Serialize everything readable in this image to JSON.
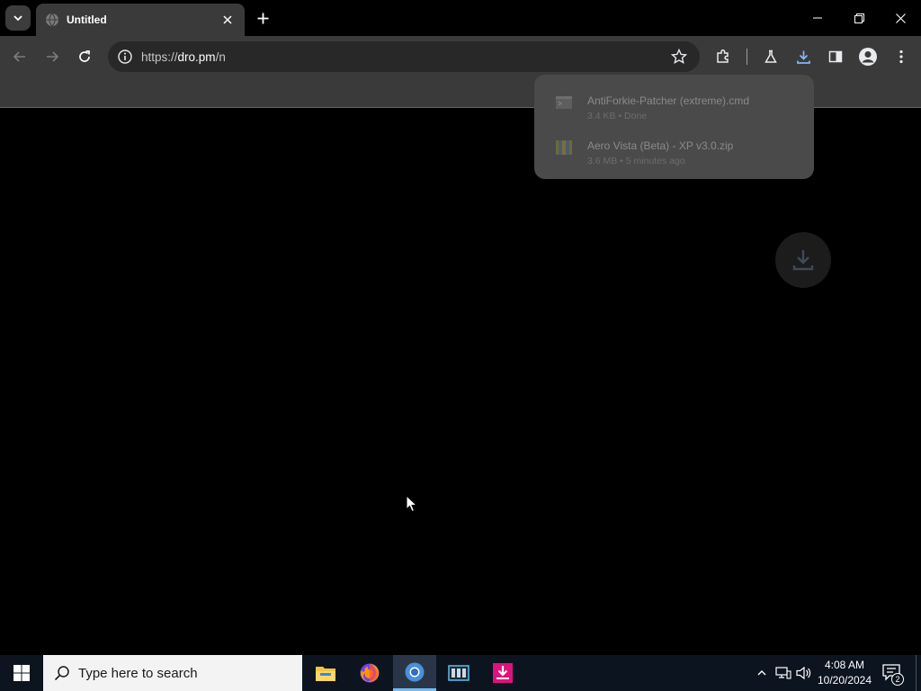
{
  "browser": {
    "tab": {
      "title": "Untitled"
    },
    "omnibox": {
      "url_scheme": "https://",
      "url_domain": "dro.pm",
      "url_path": "/n"
    },
    "downloads": [
      {
        "name": "AntiForkie-Patcher (extreme).cmd",
        "status": "3.4 KB • Done",
        "icon": "cmd-file-icon"
      },
      {
        "name": "Aero Vista (Beta) - XP v3.0.zip",
        "status": "3.6 MB • 5 minutes ago",
        "icon": "zip-file-icon"
      }
    ]
  },
  "taskbar": {
    "search_placeholder": "Type here to search",
    "apps": [
      "file-explorer",
      "firefox",
      "chrome",
      "video-editor",
      "download-manager"
    ],
    "clock": {
      "time": "4:08 AM",
      "date": "10/20/2024"
    },
    "notification_count": "2"
  },
  "colors": {
    "accent_download": "#8ab4f8",
    "taskbar_bg": "#0c1420",
    "toolbar_bg": "#3a3a3a"
  }
}
